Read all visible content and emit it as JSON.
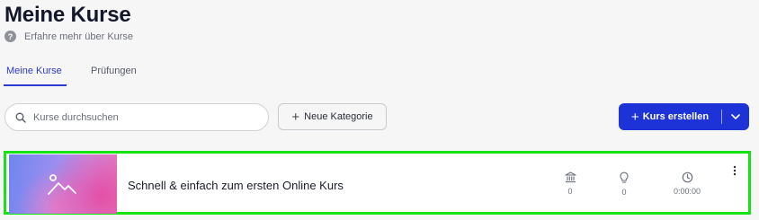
{
  "page": {
    "title": "Meine Kurse",
    "help_text": "Erfahre mehr über Kurse"
  },
  "tabs": [
    {
      "label": "Meine Kurse",
      "active": true
    },
    {
      "label": "Prüfungen",
      "active": false
    }
  ],
  "toolbar": {
    "search_placeholder": "Kurse durchsuchen",
    "search_value": "",
    "new_category_label": "Neue Kategorie",
    "create_course_label": "Kurs erstellen"
  },
  "courses": [
    {
      "title": "Schnell & einfach zum ersten Online Kurs",
      "stats": {
        "institution_count": "0",
        "idea_count": "0",
        "duration": "0:00:00"
      }
    }
  ],
  "colors": {
    "accent": "#1d33d8",
    "tab_active": "#2c3ad1",
    "highlight_border": "#16e316",
    "background": "#f6f6f7"
  },
  "icons": {
    "help": "question-circle-icon",
    "search": "search-icon",
    "add": "plus-icon",
    "dropdown": "chevron-down-icon",
    "thumbnail": "image-placeholder-icon",
    "stat_1": "bank-icon",
    "stat_2": "lightbulb-icon",
    "stat_3": "clock-icon",
    "menu": "more-vertical-icon"
  }
}
